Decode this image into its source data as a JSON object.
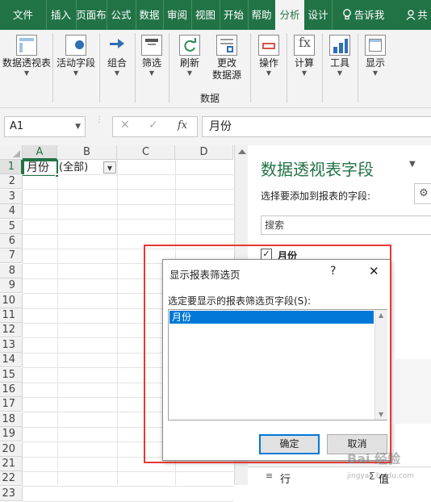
{
  "tabs": [
    {
      "label": "文件"
    },
    {
      "label": "插入"
    },
    {
      "label": "页面布"
    },
    {
      "label": "公式"
    },
    {
      "label": "数据"
    },
    {
      "label": "审阅"
    },
    {
      "label": "视图"
    },
    {
      "label": "开始"
    },
    {
      "label": "帮助"
    },
    {
      "label": "分析"
    },
    {
      "label": "设计"
    },
    {
      "label": "告诉我"
    },
    {
      "label": "共"
    }
  ],
  "ribbon": {
    "pivottable": "数据透视表",
    "active_field": "活动字段",
    "group": "组合",
    "filter": "筛选",
    "refresh": "刷新",
    "change_source_1": "更改",
    "change_source_2": "数据源",
    "data_group": "数据",
    "actions": "操作",
    "calculations": "计算",
    "tools": "工具",
    "show": "显示"
  },
  "formula_bar": {
    "name_box": "A1",
    "fx": "fx",
    "content": "月份"
  },
  "sheet": {
    "columns": [
      "A",
      "B",
      "C",
      "D"
    ],
    "rows": [
      "1",
      "2",
      "3",
      "4",
      "5",
      "6",
      "7",
      "8",
      "9",
      "10",
      "11",
      "12",
      "13",
      "14",
      "15",
      "16",
      "17",
      "18",
      "19",
      "20",
      "21",
      "22",
      "23"
    ],
    "a1": "月份",
    "b1": "(全部)"
  },
  "pane": {
    "title": "数据透视表字段",
    "subtitle": "选择要添加到报表的字段:",
    "search_placeholder": "搜索",
    "field_1": "月份",
    "rows_label": "行",
    "values_label": "值"
  },
  "dialog": {
    "title": "显示报表筛选页",
    "help": "?",
    "close": "✕",
    "prompt": "选定要显示的报表筛选页字段(S):",
    "list_items": [
      "月份"
    ],
    "ok": "确定",
    "cancel": "取消"
  },
  "watermark": "jingyan.baidu.com",
  "colors": {
    "excel_green": "#217346",
    "highlight_red": "#e53935",
    "selection_blue": "#0078d7",
    "ok_border": "#0078d7"
  }
}
